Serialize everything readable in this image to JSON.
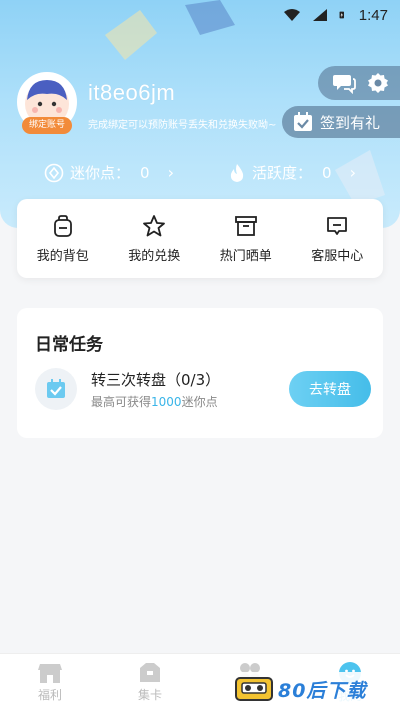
{
  "status_bar": {
    "time": "1:47"
  },
  "profile": {
    "username": "it8eo6jm",
    "bind_badge": "绑定账号",
    "bind_hint": "完成绑定可以预防账号丢失和兑换失败呦~"
  },
  "header_actions": {
    "chat_icon": "chat-icon",
    "settings_icon": "gear-icon",
    "checkin_label": "签到有礼"
  },
  "stats": {
    "mini_points_label": "迷你点：",
    "mini_points_value": "0",
    "activity_label": "活跃度：",
    "activity_value": "0"
  },
  "quick_menu": [
    {
      "label": "我的背包",
      "icon": "backpack-icon"
    },
    {
      "label": "我的兑换",
      "icon": "star-icon"
    },
    {
      "label": "热门晒单",
      "icon": "box-icon"
    },
    {
      "label": "客服中心",
      "icon": "message-icon"
    }
  ],
  "daily_tasks": {
    "title": "日常任务",
    "task": {
      "name": "转三次转盘（0/3）",
      "desc_prefix": "最高可获得",
      "desc_highlight": "1000",
      "desc_suffix": "迷你点",
      "button": "去转盘"
    }
  },
  "tabbar": [
    {
      "label": "福利",
      "icon": "shop-icon",
      "active": false
    },
    {
      "label": "集卡",
      "icon": "card-box-icon",
      "active": false
    },
    {
      "label": "活动",
      "icon": "grid-icon",
      "active": false
    },
    {
      "label": "我的",
      "icon": "smile-icon",
      "active": true
    }
  ],
  "watermark": {
    "text": "80后下载"
  },
  "colors": {
    "accent": "#3ab5e8",
    "badge": "#f28b3a",
    "header": "#a5dcf8"
  }
}
